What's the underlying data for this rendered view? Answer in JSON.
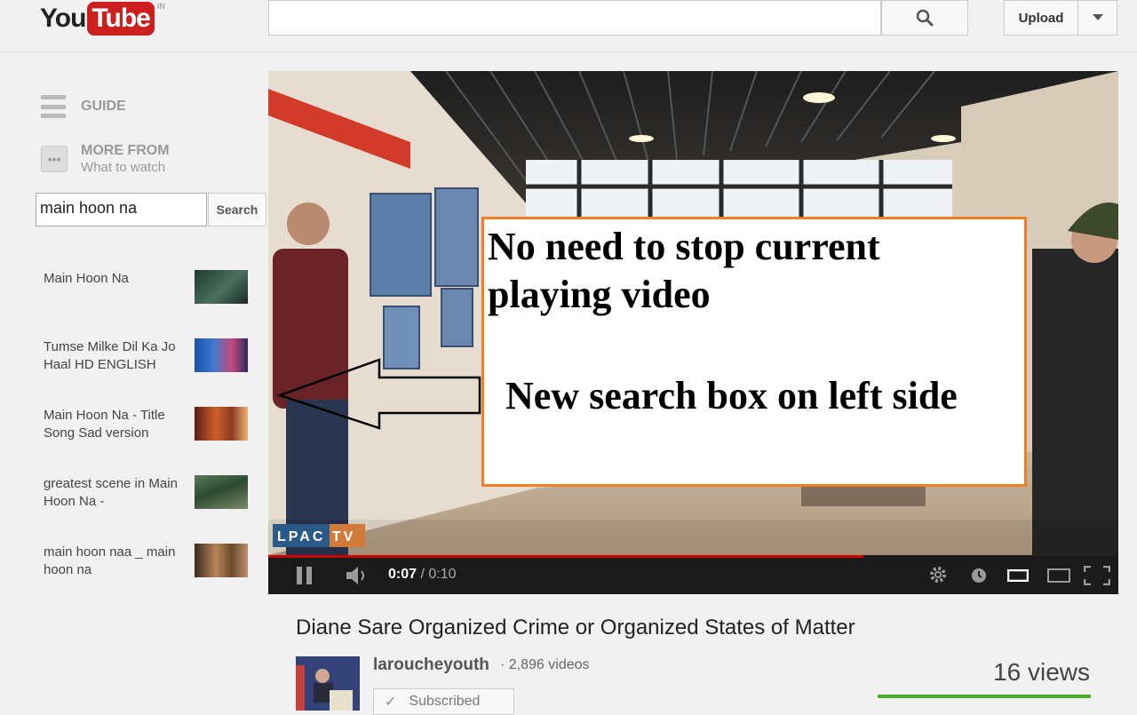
{
  "header": {
    "logo_you": "You",
    "logo_tube": "Tube",
    "country": "IN",
    "search_value": "",
    "upload_label": "Upload"
  },
  "sidebar": {
    "guide_label": "GUIDE",
    "more_from": "MORE FROM",
    "more_sub": "What to watch",
    "search_value": "main hoon na",
    "search_button": "Search",
    "results": [
      {
        "title": "Main Hoon Na",
        "thumb_color": "#2e4a3a"
      },
      {
        "title": "Tumse Milke Dil Ka Jo Haal HD ENGLISH",
        "thumb_color": "#2a55a0"
      },
      {
        "title": "Main Hoon Na - Title Song Sad version",
        "thumb_color": "#8a3a22"
      },
      {
        "title": "greatest scene in Main Hoon Na -",
        "thumb_color": "#3d5a3a"
      },
      {
        "title": "main hoon naa _ main hoon na",
        "thumb_color": "#7a5a3a"
      }
    ]
  },
  "player": {
    "current_time": "0:07",
    "duration": "0:10",
    "progress_fraction": 0.7,
    "watermark": "LPAC TV"
  },
  "overlay": {
    "line1": "No need to stop current",
    "line2": "playing video",
    "line3": "New search box on left side",
    "border_color": "#f07e26"
  },
  "video_info": {
    "title": "Diane Sare Organized Crime or Organized States of Matter",
    "channel": "laroucheyouth",
    "channel_videos": "· 2,896 videos",
    "subscribed_label": "Subscribed",
    "views": "16 views"
  }
}
